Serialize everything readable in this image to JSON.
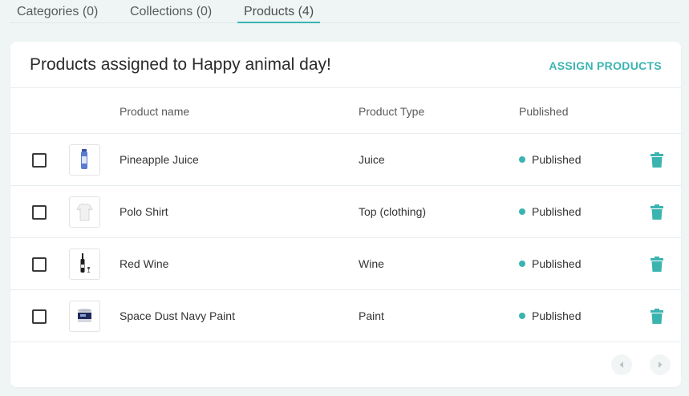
{
  "tabs": [
    {
      "label": "Categories (0)",
      "active": false
    },
    {
      "label": "Collections (0)",
      "active": false
    },
    {
      "label": "Products (4)",
      "active": true
    }
  ],
  "card": {
    "title": "Products assigned to Happy animal day!",
    "assign_label": "ASSIGN PRODUCTS"
  },
  "table": {
    "columns": [
      "Product name",
      "Product Type",
      "Published"
    ],
    "rows": [
      {
        "name": "Pineapple Juice",
        "type": "Juice",
        "status": "Published",
        "thumb": "juice-bottle-icon"
      },
      {
        "name": "Polo Shirt",
        "type": "Top (clothing)",
        "status": "Published",
        "thumb": "shirt-icon"
      },
      {
        "name": "Red Wine",
        "type": "Wine",
        "status": "Published",
        "thumb": "wine-bottle-icon"
      },
      {
        "name": "Space Dust Navy Paint",
        "type": "Paint",
        "status": "Published",
        "thumb": "paint-can-icon"
      }
    ]
  },
  "colors": {
    "accent": "#3bb4b0",
    "background": "#eff5f5"
  }
}
